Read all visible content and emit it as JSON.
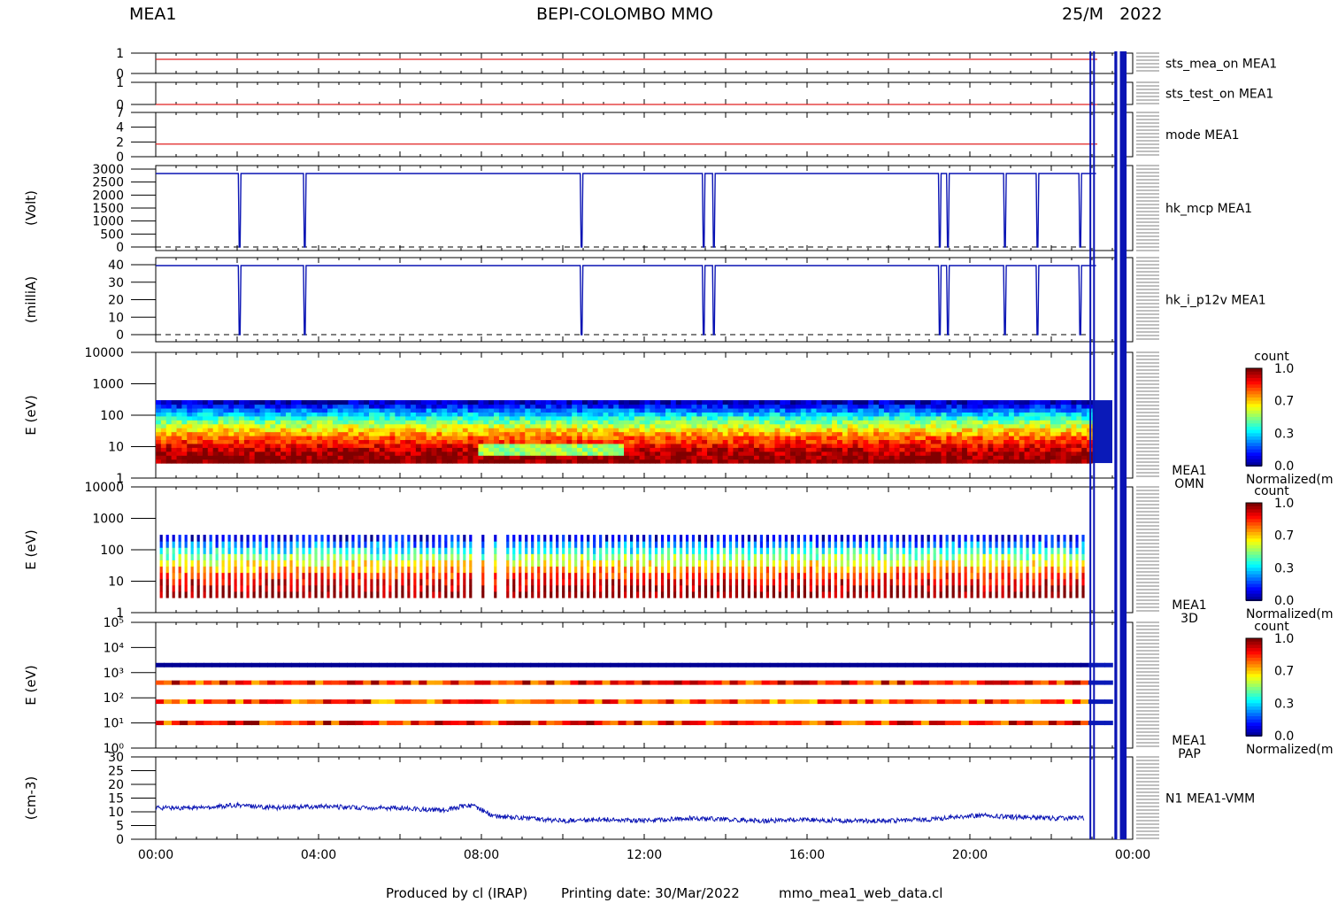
{
  "header": {
    "instrument": "MEA1",
    "mission": "BEPI-COLOMBO MMO",
    "date": "25/M   2022"
  },
  "footer": {
    "produced_by": "Produced by cl (IRAP)",
    "printing_date": "Printing date: 30/Mar/2022",
    "script": "mmo_mea1_web_data.cl"
  },
  "colors": {
    "status_line": "#e02020",
    "trace": "#0a14b4",
    "spectro_bg": "#0a1ab8"
  },
  "chart_data": [
    {
      "type": "line",
      "name": "sts_mea_on MEA1",
      "label": "sts_mea_on MEA1",
      "ylabel": "",
      "ytick_labels": [
        "1",
        "0"
      ],
      "ylim": [
        0,
        1
      ],
      "x": [
        0,
        24
      ],
      "values": [
        1,
        1
      ],
      "color": "#e02020"
    },
    {
      "type": "line",
      "name": "sts_test_on MEA1",
      "label": "sts_test_on MEA1",
      "ylabel": "",
      "ytick_labels": [
        "1",
        "0"
      ],
      "ylim": [
        0,
        1
      ],
      "x": [
        0,
        24
      ],
      "values": [
        0,
        0
      ],
      "color": "#e02020"
    },
    {
      "type": "line",
      "name": "mode MEA1",
      "label": "mode MEA1",
      "ylabel": "",
      "ytick_labels": [
        "7",
        "4",
        "2",
        "0"
      ],
      "ylim": [
        0,
        7
      ],
      "x": [
        0,
        24
      ],
      "values": [
        2,
        2
      ],
      "color": "#e02020"
    },
    {
      "type": "line",
      "name": "hk_mcp MEA1",
      "label": "hk_mcp MEA1",
      "ylabel": "(Volt)",
      "ytick_labels": [
        "3000",
        "2500",
        "2000",
        "1500",
        "1000",
        "500",
        "0"
      ],
      "ylim": [
        0,
        3000
      ],
      "baseline_value": 2800,
      "dips_hours": [
        2.05,
        3.65,
        10.45,
        13.45,
        13.7,
        19.25,
        19.45,
        20.85,
        21.65,
        22.7
      ],
      "color": "#0a14b4"
    },
    {
      "type": "line",
      "name": "hk_i_p12v MEA1",
      "label": "hk_i_p12v MEA1",
      "ylabel": "(milliA)",
      "ytick_labels": [
        "40",
        "30",
        "20",
        "10",
        "0"
      ],
      "ylim": [
        -5,
        45
      ],
      "baseline_value": 39,
      "dips_hours": [
        2.05,
        3.65,
        10.45,
        13.45,
        13.7,
        19.25,
        19.45,
        20.85,
        21.65,
        22.7
      ],
      "color": "#0a14b4"
    },
    {
      "type": "heatmap",
      "name": "MEA1 OMN",
      "label": [
        "MEA1",
        "OMN"
      ],
      "ylabel": "E (eV)",
      "ytick_labels": [
        "10000",
        "1000",
        "100",
        "10",
        "1"
      ],
      "ylim": [
        1,
        10000
      ],
      "yscale": "log",
      "colorbar": {
        "title": "count",
        "ticks": [
          "1.0",
          "0.7",
          "0.3",
          "0.0"
        ],
        "label": "Normalized(m"
      }
    },
    {
      "type": "heatmap",
      "name": "MEA1 3D",
      "label": [
        "MEA1",
        "3D"
      ],
      "ylabel": "E (eV)",
      "ytick_labels": [
        "10000",
        "1000",
        "100",
        "10",
        "1"
      ],
      "ylim": [
        1,
        10000
      ],
      "yscale": "log",
      "colorbar": {
        "title": "count",
        "ticks": [
          "1.0",
          "0.7",
          "0.3",
          "0.0"
        ],
        "label": "Normalized(m"
      }
    },
    {
      "type": "heatmap",
      "name": "MEA1 PAP",
      "label": [
        "MEA1",
        "PAP"
      ],
      "ylabel": "E (eV)",
      "ytick_labels": [
        "10⁵",
        "10⁴",
        "10³",
        "10²",
        "10¹",
        "10⁰"
      ],
      "ylim": [
        1,
        100000
      ],
      "yscale": "log",
      "colorbar": {
        "title": "count",
        "ticks": [
          "1.0",
          "0.7",
          "0.3",
          "0.0"
        ],
        "label": "Normalized(m"
      }
    },
    {
      "type": "line",
      "name": "N1 MEA1-VMM",
      "label": "N1 MEA1-VMM",
      "ylabel": "(cm-3)",
      "ytick_labels": [
        "30",
        "25",
        "20",
        "15",
        "10",
        "5",
        "0"
      ],
      "ylim": [
        0,
        30
      ],
      "x": [
        0,
        1,
        2,
        3,
        4,
        5,
        6,
        7,
        7.7,
        7.9,
        8.3,
        9,
        10,
        11,
        12,
        13,
        14,
        15,
        16,
        17,
        18,
        19,
        20,
        20.5,
        21,
        22,
        22.8
      ],
      "values": [
        12,
        12,
        13,
        12,
        12.5,
        12,
        12,
        11,
        13,
        12,
        9,
        8,
        7,
        7.5,
        7,
        8,
        7.5,
        7,
        7.5,
        7,
        7,
        7.5,
        9,
        9,
        8.5,
        8,
        8
      ],
      "color": "#0a14b4"
    }
  ],
  "xaxis": {
    "tick_labels": [
      "00:00",
      "04:00",
      "08:00",
      "12:00",
      "16:00",
      "20:00",
      "00:00"
    ],
    "range_hours": [
      0,
      24
    ]
  }
}
